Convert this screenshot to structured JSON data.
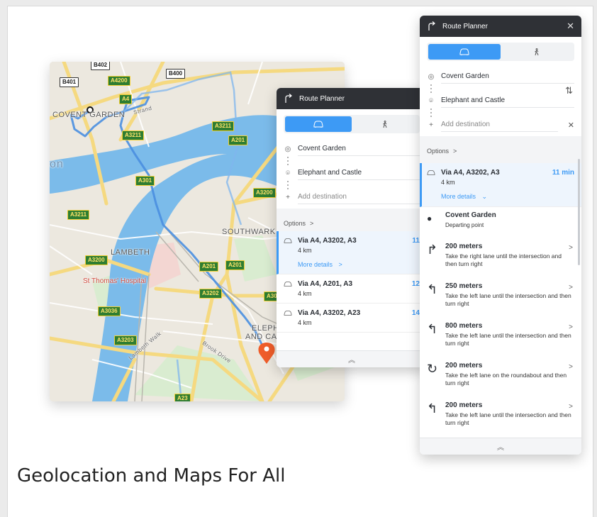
{
  "headline": "Geolocation and Maps For All",
  "colors": {
    "accent": "#3d9af5",
    "header_bg": "#2f3136",
    "route_line": "#4a8fe0",
    "destination_pin": "#ef5d2a"
  },
  "map": {
    "road_labels_a": [
      "A4200",
      "A4",
      "A3211",
      "A3211",
      "A201",
      "A3211",
      "A301",
      "A3200",
      "A3200",
      "A201",
      "A201",
      "A3202",
      "A3036",
      "A3203",
      "A23",
      "A30"
    ],
    "road_labels_b": [
      "B402",
      "B401",
      "B400"
    ],
    "places": [
      "COVENT GARDEN",
      "SOUTHWARK",
      "LAMBETH",
      "ELEPHANT",
      "AND CASTLE"
    ],
    "street_names": [
      "Strand",
      "Lambeth Walk",
      "Brook Drive"
    ],
    "poi": "St Thomas' Hospital",
    "water_text": "on"
  },
  "planner_mid": {
    "title": "Route Planner",
    "origin": "Covent Garden",
    "destination": "Elephant and Castle",
    "add_destination": "Add destination",
    "options_label": "Options",
    "options_chevron": ">",
    "routes": [
      {
        "name": "Via A4, A3202, A3",
        "distance": "4 km",
        "time": "11",
        "more": "More details",
        "more_chevron": ">"
      },
      {
        "name": "Via A4, A201, A3",
        "distance": "4 km",
        "time": "12"
      },
      {
        "name": "Via A4, A3202, A23",
        "distance": "4 km",
        "time": "14"
      }
    ],
    "collapse_icon": "︽"
  },
  "planner_front": {
    "title": "Route Planner",
    "close_icon": "✕",
    "origin": "Covent Garden",
    "destination": "Elephant and Castle",
    "add_destination": "Add destination",
    "add_icon": "+",
    "remove_icon": "✕",
    "swap_icon": "⇅",
    "options_label": "Options",
    "options_chevron": ">",
    "active_route": {
      "name": "Via A4, A3202, A3",
      "distance": "4 km",
      "time": "11 min",
      "more": "More details",
      "more_chevron": "⌄"
    },
    "steps": [
      {
        "icon": "●",
        "icon_name": "departure-icon",
        "distance": "Covent Garden",
        "description": "Departing point",
        "chevron": ""
      },
      {
        "icon": "↱",
        "icon_name": "turn-right-icon",
        "distance": "200 meters",
        "description": "Take the right lane until the intersection and then turn right",
        "chevron": ">"
      },
      {
        "icon": "↰",
        "icon_name": "turn-left-icon",
        "distance": "250 meters",
        "description": "Take the left lane until the intersection and then turn right",
        "chevron": ">"
      },
      {
        "icon": "↰",
        "icon_name": "turn-left-icon",
        "distance": "800 meters",
        "description": "Take the left lane until the intersection and then turn right",
        "chevron": ">"
      },
      {
        "icon": "↻",
        "icon_name": "roundabout-icon",
        "distance": "200 meters",
        "description": "Take the left lane on the roundabout and then turn right",
        "chevron": ">"
      },
      {
        "icon": "↰",
        "icon_name": "turn-left-icon",
        "distance": "200 meters",
        "description": "Take the left lane until the intersection and then turn right",
        "chevron": ">"
      }
    ],
    "collapse_icon": "︽"
  }
}
